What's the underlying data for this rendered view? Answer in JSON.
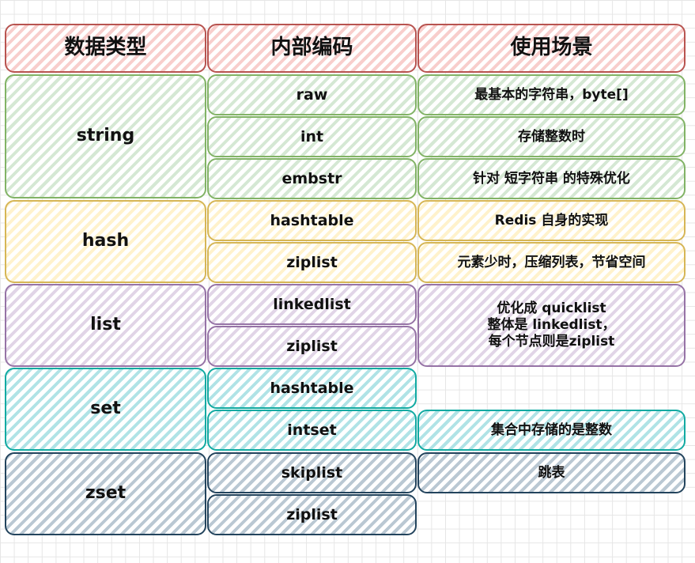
{
  "header": {
    "type": "数据类型",
    "encoding": "内部编码",
    "scenario": "使用场景"
  },
  "types": [
    {
      "name": "string"
    },
    {
      "name": "hash"
    },
    {
      "name": "list"
    },
    {
      "name": "set"
    },
    {
      "name": "zset"
    }
  ],
  "encodings": [
    "raw",
    "int",
    "embstr",
    "hashtable",
    "ziplist",
    "linkedlist",
    "ziplist",
    "hashtable",
    "intset",
    "skiplist",
    "ziplist"
  ],
  "scenarios": [
    "最基本的字符串，byte[]",
    "存储整数时",
    "针对 短字符串 的特殊优化",
    "Redis 自身的实现",
    "元素少时，压缩列表，节省空间",
    "优化成 quicklist\n整体是 linkedlist，\n每个节点则是ziplist",
    "集合中存储的是整数",
    "跳表"
  ],
  "colors": {
    "header": "#b85450",
    "string": "#82b366",
    "hash": "#d6b656",
    "list": "#9673a6",
    "set": "#12aaa2",
    "zset": "#23445d"
  }
}
